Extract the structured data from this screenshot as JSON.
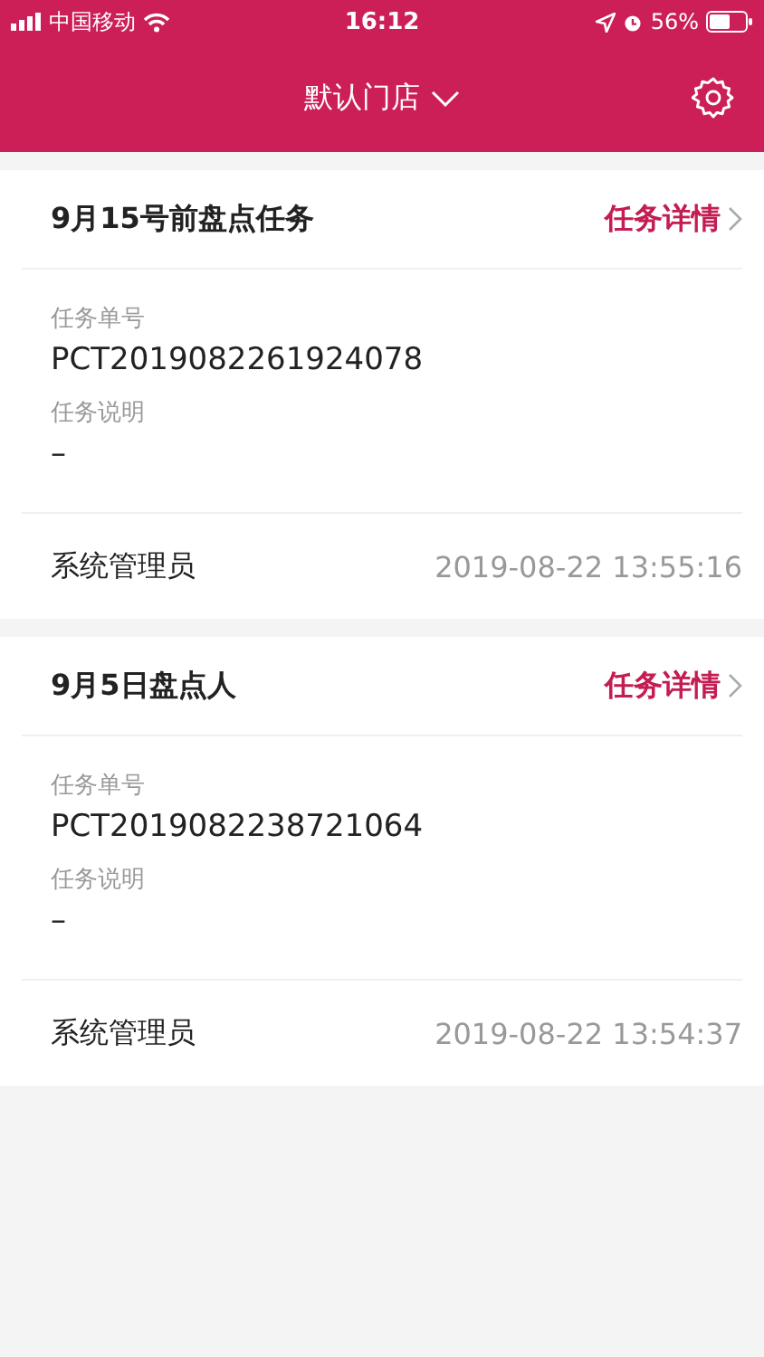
{
  "status_bar": {
    "carrier": "中国移动",
    "time": "16:12",
    "battery": "56%"
  },
  "header": {
    "title": "默认门店"
  },
  "tasks": [
    {
      "title": "9月15号前盘点任务",
      "detail_link": "任务详情",
      "fields": [
        {
          "label": "任务单号",
          "value": "PCT2019082261924078"
        },
        {
          "label": "任务说明",
          "value": "–"
        }
      ],
      "creator": "系统管理员",
      "time": "2019-08-22 13:55:16"
    },
    {
      "title": "9月5日盘点人",
      "detail_link": "任务详情",
      "fields": [
        {
          "label": "任务单号",
          "value": "PCT2019082238721064"
        },
        {
          "label": "任务说明",
          "value": "–"
        }
      ],
      "creator": "系统管理员",
      "time": "2019-08-22 13:54:37"
    }
  ]
}
